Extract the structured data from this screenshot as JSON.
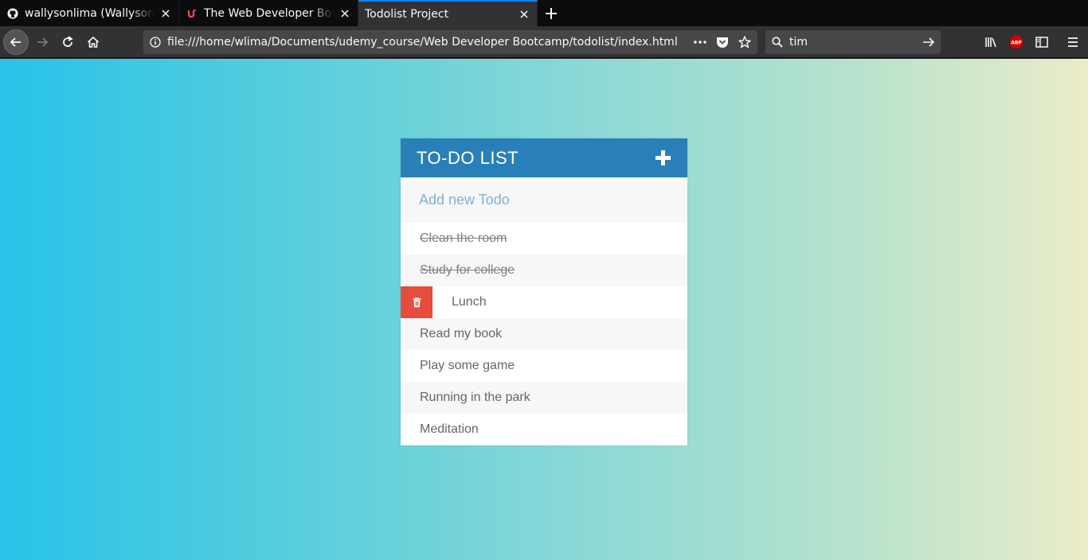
{
  "browser": {
    "tabs": [
      {
        "title": "wallysonlima (Wallyson Lima)",
        "favicon": "github-icon",
        "active": false
      },
      {
        "title": "The Web Developer Bootcamp",
        "favicon": "udemy-icon",
        "active": false
      },
      {
        "title": "Todolist Project",
        "favicon": "",
        "active": true
      }
    ],
    "url": "file:///home/wlima/Documents/udemy_course/Web Developer Bootcamp/todolist/index.html",
    "search_query": "tim",
    "accent_color": "#0a84ff"
  },
  "todo": {
    "title": "TO-DO LIST",
    "input_placeholder": "Add new Todo",
    "header_color": "#2980b9",
    "delete_color": "#e74c3c",
    "items": [
      {
        "text": "Clean the room",
        "completed": true
      },
      {
        "text": "Study for college",
        "completed": true
      },
      {
        "text": "Lunch",
        "completed": false,
        "hovered": true
      },
      {
        "text": "Read my book",
        "completed": false
      },
      {
        "text": "Play some game",
        "completed": false
      },
      {
        "text": "Running in the park",
        "completed": false
      },
      {
        "text": "Meditation",
        "completed": false
      }
    ]
  }
}
